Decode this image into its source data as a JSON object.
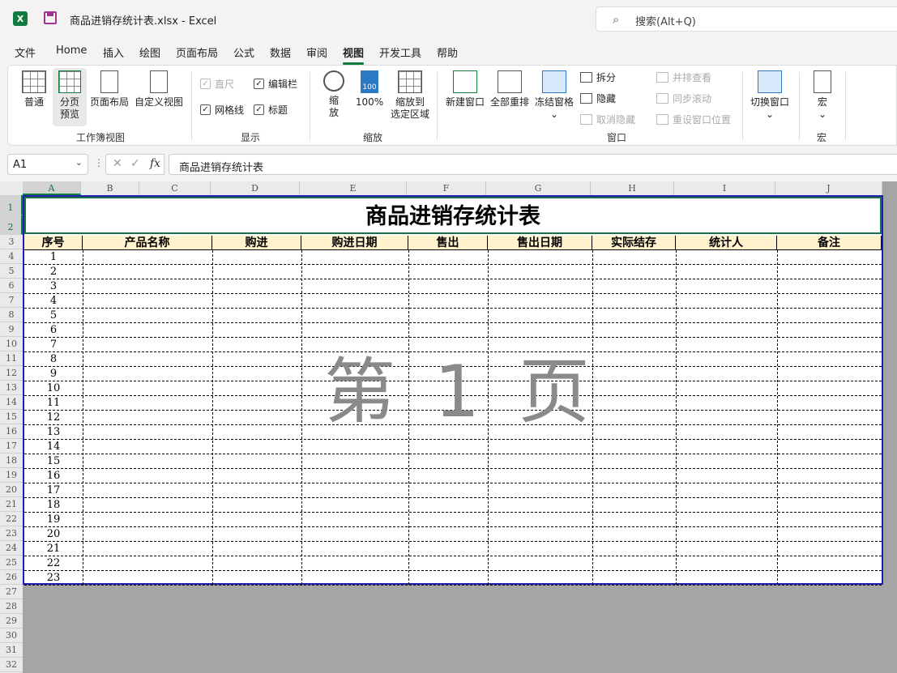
{
  "app": {
    "icon": "X",
    "doc_title": "商品进销存统计表.xlsx  -  Excel",
    "search_placeholder": "搜索(Alt+Q)"
  },
  "tabs": [
    "文件",
    "Home",
    "插入",
    "绘图",
    "页面布局",
    "公式",
    "数据",
    "审阅",
    "视图",
    "开发工具",
    "帮助"
  ],
  "active_tab": "视图",
  "ribbon": {
    "workbook_views": {
      "normal": "普通",
      "page_break_1": "分页",
      "page_break_2": "预览",
      "page_layout": "页面布局",
      "custom_views": "自定义视图",
      "group": "工作簿视图"
    },
    "show": {
      "ruler": "直尺",
      "formula_bar": "编辑栏",
      "gridlines": "网格线",
      "headings": "标题",
      "group": "显示"
    },
    "zoom": {
      "zoom_1": "缩",
      "zoom_2": "放",
      "hundred": "100%",
      "to_sel_1": "缩放到",
      "to_sel_2": "选定区域",
      "group": "缩放",
      "icon_text": "100"
    },
    "window": {
      "new": "新建窗口",
      "arrange": "全部重排",
      "freeze": "冻结窗格",
      "split": "拆分",
      "hide": "隐藏",
      "unhide": "取消隐藏",
      "side_by_side": "并排查看",
      "sync_scroll": "同步滚动",
      "reset_pos": "重设窗口位置",
      "switch": "切换窗口",
      "group": "窗口"
    },
    "macros": {
      "label": "宏",
      "group": "宏"
    },
    "checks": {
      "ruler": false,
      "formula_bar": true,
      "gridlines": true,
      "headings": true
    }
  },
  "formula_bar": {
    "cell_ref": "A1",
    "content": "商品进销存统计表",
    "fx": "fx"
  },
  "columns": [
    "A",
    "B",
    "C",
    "D",
    "E",
    "F",
    "G",
    "H",
    "I",
    "J"
  ],
  "rows_visible": [
    "1",
    "2",
    "3",
    "4",
    "5",
    "6",
    "7",
    "8",
    "9",
    "10",
    "11",
    "12",
    "13",
    "14",
    "15",
    "16",
    "17",
    "18",
    "19",
    "20",
    "21",
    "22",
    "23",
    "24",
    "25",
    "26",
    "27",
    "28",
    "29",
    "30",
    "31",
    "32"
  ],
  "sheet": {
    "title": "商品进销存统计表",
    "headers": [
      "序号",
      "产品名称",
      "购进",
      "购进日期",
      "售出",
      "售出日期",
      "实际结存",
      "统计人",
      "备注"
    ],
    "serials": [
      "1",
      "2",
      "3",
      "4",
      "5",
      "6",
      "7",
      "8",
      "9",
      "10",
      "11",
      "12",
      "13",
      "14",
      "15",
      "16",
      "17",
      "18",
      "19",
      "20",
      "21",
      "22",
      "23"
    ],
    "watermark": "第 1 页"
  },
  "colors": {
    "accent": "#107c41",
    "header_fill": "#fff2cc",
    "page_border": "#1f1fb4",
    "background": "#a5a5a5"
  }
}
